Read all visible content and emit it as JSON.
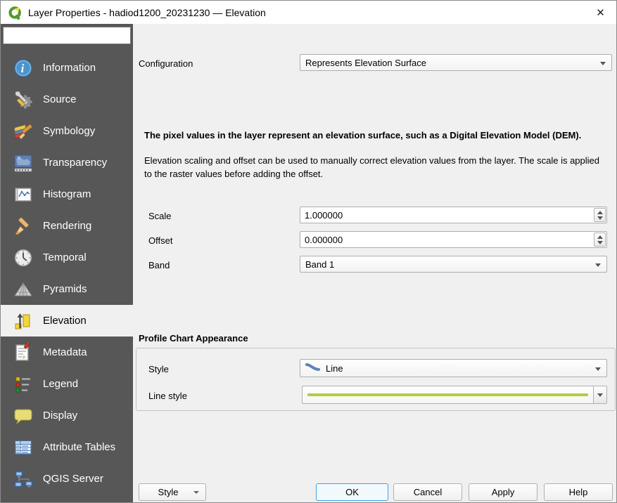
{
  "window": {
    "title": "Layer Properties - hadiod1200_20231230 — Elevation",
    "close_glyph": "✕"
  },
  "colors": {
    "sidebar_bg": "#575757",
    "accent_blue": "#3ca3dd",
    "profile_line_green": "#b5cc3e",
    "style_line_icon_blue": "#5b83b8"
  },
  "sidebar": {
    "search_placeholder": "",
    "items": [
      {
        "label": "Information",
        "icon": "info-icon",
        "selected": false
      },
      {
        "label": "Source",
        "icon": "source-icon",
        "selected": false
      },
      {
        "label": "Symbology",
        "icon": "symbology-icon",
        "selected": false
      },
      {
        "label": "Transparency",
        "icon": "transparency-icon",
        "selected": false
      },
      {
        "label": "Histogram",
        "icon": "histogram-icon",
        "selected": false
      },
      {
        "label": "Rendering",
        "icon": "rendering-icon",
        "selected": false
      },
      {
        "label": "Temporal",
        "icon": "temporal-icon",
        "selected": false
      },
      {
        "label": "Pyramids",
        "icon": "pyramids-icon",
        "selected": false
      },
      {
        "label": "Elevation",
        "icon": "elevation-icon",
        "selected": true
      },
      {
        "label": "Metadata",
        "icon": "metadata-icon",
        "selected": false
      },
      {
        "label": "Legend",
        "icon": "legend-icon",
        "selected": false
      },
      {
        "label": "Display",
        "icon": "display-icon",
        "selected": false
      },
      {
        "label": "Attribute Tables",
        "icon": "attribute-tables-icon",
        "selected": false
      },
      {
        "label": "QGIS Server",
        "icon": "qgis-server-icon",
        "selected": false
      }
    ]
  },
  "main": {
    "configuration": {
      "label": "Configuration",
      "value": "Represents Elevation Surface"
    },
    "description_bold": "The pixel values in the layer represent an elevation surface, such as a Digital Elevation Model (DEM).",
    "description_text": "Elevation scaling and offset can be used to manually correct elevation values from the layer. The scale is applied to the raster values before adding the offset.",
    "scale": {
      "label": "Scale",
      "value": "1.000000"
    },
    "offset": {
      "label": "Offset",
      "value": "0.000000"
    },
    "band": {
      "label": "Band",
      "value": "Band 1"
    },
    "profile_group": {
      "title": "Profile Chart Appearance",
      "style": {
        "label": "Style",
        "value": "Line"
      },
      "line_style": {
        "label": "Line style"
      }
    }
  },
  "footer": {
    "style_button": "Style",
    "ok": "OK",
    "cancel": "Cancel",
    "apply": "Apply",
    "help": "Help"
  }
}
